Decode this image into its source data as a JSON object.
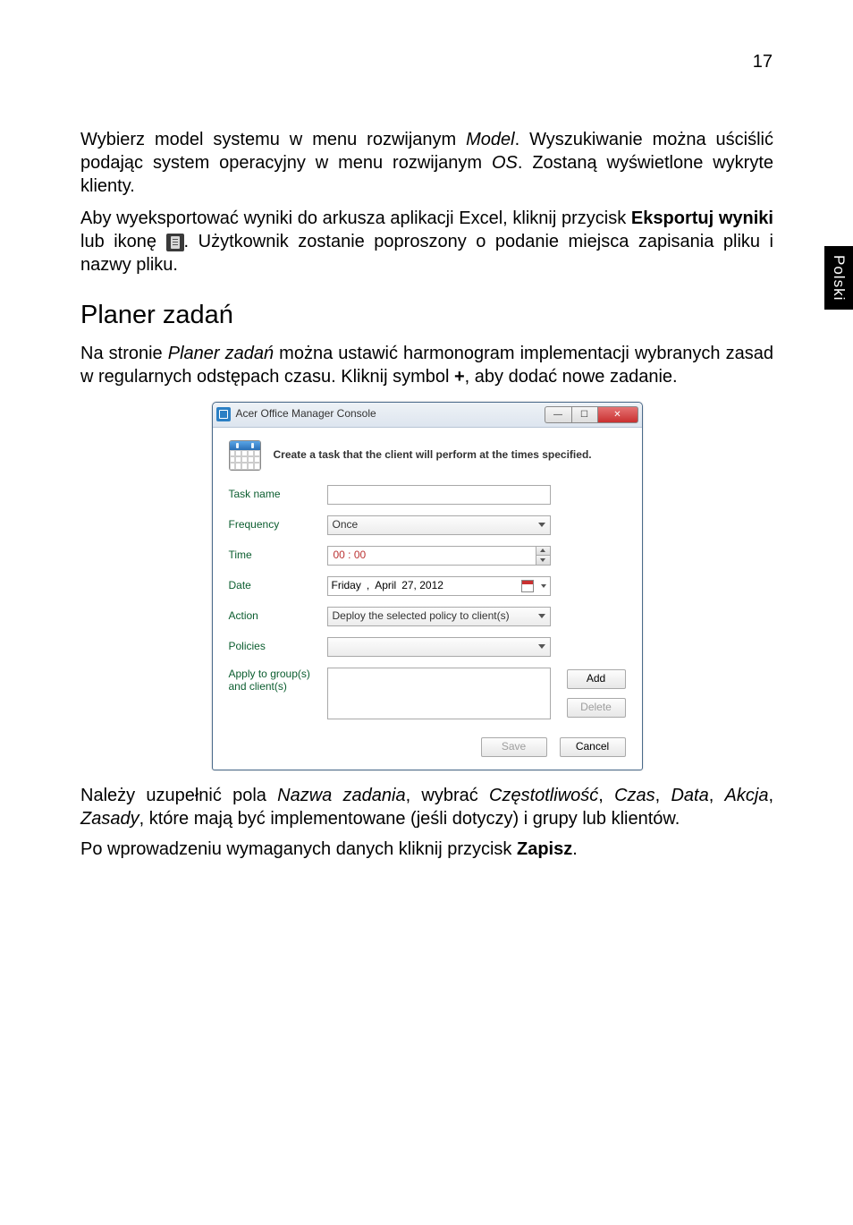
{
  "page_number": "17",
  "side_tab": "Polski",
  "para1": {
    "t1": "Wybierz model systemu w menu rozwijanym ",
    "i1": "Model",
    "t2": ". Wyszukiwanie można uściślić podając system operacyjny w menu rozwijanym ",
    "i2": "OS",
    "t3": ". Zostaną wyświetlone wykryte klienty."
  },
  "para2": {
    "t1": "Aby wyeksportować wyniki do arkusza aplikacji Excel, kliknij przycisk ",
    "b1": "Eksportuj wyniki",
    "t2": " lub ikonę ",
    "t3": ". Użytkownik zostanie poproszony o podanie miejsca zapisania pliku i nazwy pliku."
  },
  "heading": "Planer zadań",
  "para3": {
    "t1": "Na stronie ",
    "i1": "Planer zadań",
    "t2": " można ustawić harmonogram implementacji wybranych zasad w regularnych odstępach czasu. Kliknij symbol ",
    "b1": "+",
    "t3": ", aby dodać nowe zadanie."
  },
  "window": {
    "title": "Acer Office Manager Console",
    "header_text": "Create a task that the client will perform at the times specified.",
    "labels": {
      "task_name": "Task name",
      "frequency": "Frequency",
      "time": "Time",
      "date": "Date",
      "action": "Action",
      "policies": "Policies",
      "apply": "Apply to group(s) and client(s)"
    },
    "values": {
      "frequency": "Once",
      "time": "00 : 00",
      "date_day": "Friday",
      "date_sep": ",",
      "date_month": "April",
      "date_num": "27, 2012",
      "action": "Deploy the selected policy to client(s)"
    },
    "buttons": {
      "add": "Add",
      "delete": "Delete",
      "save": "Save",
      "cancel": "Cancel"
    }
  },
  "para4": {
    "t1": "Należy uzupełnić pola ",
    "i1": "Nazwa zadania",
    "t2": ", wybrać ",
    "i2": "Częstotliwość",
    "t3": ", ",
    "i3": "Czas",
    "t4": ", ",
    "i4": "Data",
    "t5": ", ",
    "i5": "Akcja",
    "t6": ", ",
    "i6": "Zasady",
    "t7": ", które mają być implementowane (jeśli dotyczy) i grupy lub klientów."
  },
  "para5": {
    "t1": "Po wprowadzeniu wymaganych danych kliknij przycisk ",
    "b1": "Zapisz",
    "t2": "."
  }
}
